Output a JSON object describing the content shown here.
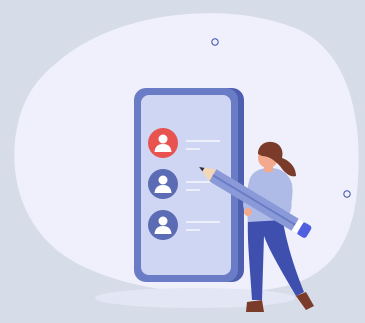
{
  "illustration": {
    "subject": "person-holding-pencil-beside-phone-with-contact-list",
    "contacts": [
      {
        "icon": "user-icon",
        "color": "#e9534f"
      },
      {
        "icon": "user-icon",
        "color": "#5b6bb4"
      },
      {
        "icon": "user-icon",
        "color": "#5b6bb4"
      }
    ],
    "colors": {
      "background": "#d6dce8",
      "blob": "#eff0fb",
      "phone_body": "#6b7cc6",
      "phone_screen": "#cfd6f3",
      "accent_red": "#e9534f",
      "accent_blue": "#5b6bb4",
      "pants": "#3f4fae",
      "hair": "#7a3b2a"
    }
  }
}
